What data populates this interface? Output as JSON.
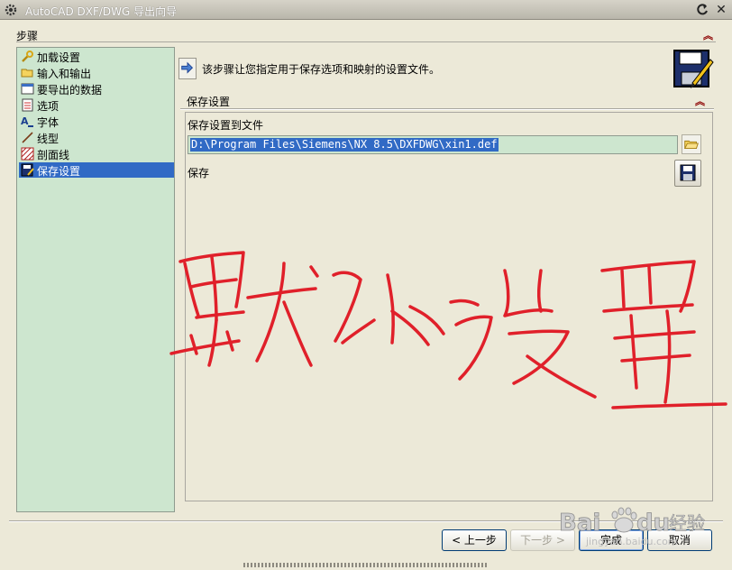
{
  "window": {
    "title": "AutoCAD DXF/DWG 导出向导"
  },
  "steps": {
    "header": "步骤",
    "items": [
      {
        "label": "加载设置",
        "icon": "wrench-icon"
      },
      {
        "label": "输入和输出",
        "icon": "folder-open-icon"
      },
      {
        "label": "要导出的数据",
        "icon": "data-window-icon"
      },
      {
        "label": "选项",
        "icon": "checklist-icon"
      },
      {
        "label": "字体",
        "icon": "font-icon"
      },
      {
        "label": "线型",
        "icon": "line-icon"
      },
      {
        "label": "剖面线",
        "icon": "hatch-icon"
      },
      {
        "label": "保存设置",
        "icon": "save-pencil-icon"
      }
    ],
    "selected_index": 7
  },
  "instruction": "该步骤让您指定用于保存选项和映射的设置文件。",
  "section": {
    "title": "保存设置",
    "file_label": "保存设置到文件",
    "file_path": "D:\\Program Files\\Siemens\\NX 8.5\\DXFDWG\\xin1.def",
    "save_label": "保存"
  },
  "buttons": {
    "back": "< 上一步",
    "next": "下一步 >",
    "finish": "完成",
    "cancel": "取消"
  },
  "watermark": {
    "brand": "Bai",
    "brand_tail": "du",
    "suffix": "经验",
    "url": "jingyan.baidu.com"
  },
  "colors": {
    "panel_green": "#cde6cf",
    "selection_blue": "#316ac5",
    "scribble_red": "#e0202a"
  }
}
